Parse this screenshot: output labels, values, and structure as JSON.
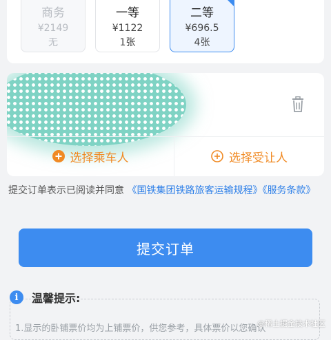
{
  "seats": [
    {
      "name": "商务",
      "price": "¥2149",
      "count": "无",
      "state": "disabled"
    },
    {
      "name": "一等",
      "price": "¥1122",
      "count": "1张",
      "state": "normal"
    },
    {
      "name": "二等",
      "price": "¥696.5",
      "count": "4张",
      "state": "selected"
    }
  ],
  "passenger": {
    "add_passenger": "选择乘车人",
    "add_beneficiary": "选择受让人"
  },
  "agreement": {
    "prefix": "提交订单表示已阅读并同意 ",
    "link1": "《国铁集团铁路旅客运输规程》",
    "link2": "《服务条款》"
  },
  "submit_label": "提交订单",
  "tips": {
    "title": "温馨提示:",
    "line1": "1.显示的卧铺票价均为上铺票价，供您参考，具体票价以您确认"
  },
  "watermark": "@稀土掘金技术社区",
  "colors": {
    "accent": "#3d8cf0",
    "orange": "#f08a24",
    "link": "#2d7fe8"
  }
}
